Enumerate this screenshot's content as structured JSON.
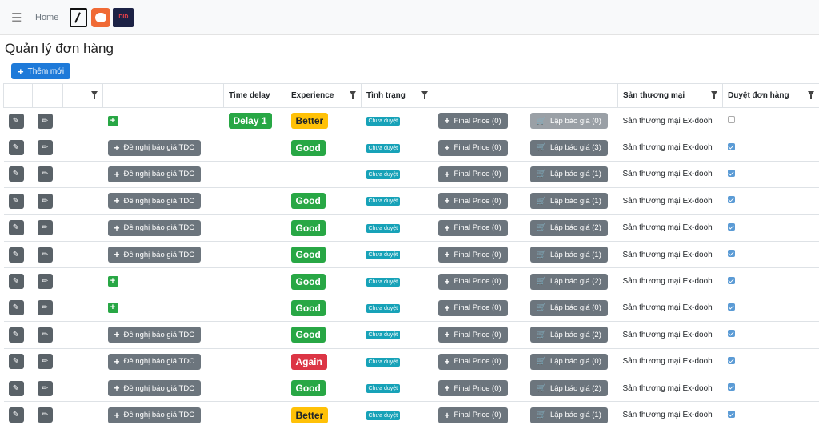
{
  "topbar": {
    "menu_icon": "hamburger-icon",
    "home": "Home",
    "logo3_text": "DID"
  },
  "page_title": "Quản lý đơn hàng",
  "add_button": "Thêm mới",
  "columns": [
    "",
    "",
    "",
    "",
    "Time delay",
    "Experience",
    "Tình trạng",
    "",
    "",
    "Sản thương mại",
    "Duyệt đơn hàng"
  ],
  "labels": {
    "propose": "Đề nghị báo giá TDC",
    "status": "Chưa duyệt",
    "shop": "Sản thương mại Ex-dooh"
  },
  "rows": [
    {
      "propose": false,
      "delay": "Delay 1",
      "exp": "Better",
      "exp_kind": "better",
      "final": "Final Price (0)",
      "quote": "Lập báo giá (0)",
      "quote_light": true,
      "approved": false
    },
    {
      "propose": true,
      "delay": "",
      "exp": "Good",
      "exp_kind": "good",
      "final": "Final Price (0)",
      "quote": "Lập báo giá (3)",
      "quote_light": false,
      "approved": true
    },
    {
      "propose": true,
      "delay": "",
      "exp": "",
      "exp_kind": "",
      "final": "Final Price (0)",
      "quote": "Lập báo giá (1)",
      "quote_light": false,
      "approved": true
    },
    {
      "propose": true,
      "delay": "",
      "exp": "Good",
      "exp_kind": "good",
      "final": "Final Price (0)",
      "quote": "Lập báo giá (1)",
      "quote_light": false,
      "approved": true
    },
    {
      "propose": true,
      "delay": "",
      "exp": "Good",
      "exp_kind": "good",
      "final": "Final Price (0)",
      "quote": "Lập báo giá (2)",
      "quote_light": false,
      "approved": true
    },
    {
      "propose": true,
      "delay": "",
      "exp": "Good",
      "exp_kind": "good",
      "final": "Final Price (0)",
      "quote": "Lập báo giá (1)",
      "quote_light": false,
      "approved": true
    },
    {
      "propose": false,
      "delay": "",
      "exp": "Good",
      "exp_kind": "good",
      "final": "Final Price (0)",
      "quote": "Lập báo giá (2)",
      "quote_light": false,
      "approved": true
    },
    {
      "propose": false,
      "delay": "",
      "exp": "Good",
      "exp_kind": "good",
      "final": "Final Price (0)",
      "quote": "Lập báo giá (0)",
      "quote_light": false,
      "approved": true
    },
    {
      "propose": true,
      "delay": "",
      "exp": "Good",
      "exp_kind": "good",
      "final": "Final Price (0)",
      "quote": "Lập báo giá (2)",
      "quote_light": false,
      "approved": true
    },
    {
      "propose": true,
      "delay": "",
      "exp": "Again",
      "exp_kind": "again",
      "final": "Final Price (0)",
      "quote": "Lập báo giá (0)",
      "quote_light": false,
      "approved": true
    },
    {
      "propose": true,
      "delay": "",
      "exp": "Good",
      "exp_kind": "good",
      "final": "Final Price (0)",
      "quote": "Lập báo giá (2)",
      "quote_light": false,
      "approved": true
    },
    {
      "propose": true,
      "delay": "",
      "exp": "Better",
      "exp_kind": "better",
      "final": "Final Price (0)",
      "quote": "Lập báo giá (1)",
      "quote_light": false,
      "approved": true
    }
  ]
}
